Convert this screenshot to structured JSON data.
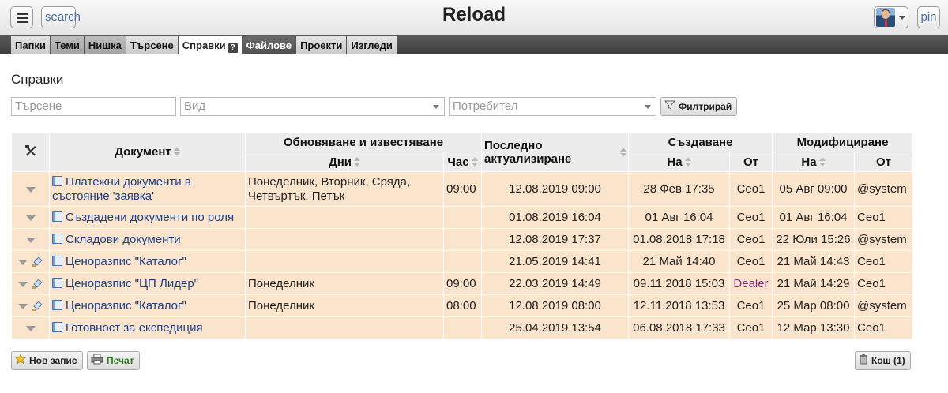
{
  "header": {
    "title": "Reload",
    "search_label": "search",
    "pin_label": "pin"
  },
  "tabs": [
    {
      "label": "Папки"
    },
    {
      "label": "Теми"
    },
    {
      "label": "Нишка"
    },
    {
      "label": "Търсене"
    },
    {
      "label": "Справки"
    },
    {
      "label": "Файлове"
    },
    {
      "label": "Проекти"
    },
    {
      "label": "Изгледи"
    }
  ],
  "page": {
    "title": "Справки"
  },
  "filters": {
    "search_placeholder": "Търсене",
    "type_placeholder": "Вид",
    "user_placeholder": "Потребител",
    "filter_button": "Филтрирай"
  },
  "table": {
    "headers": {
      "document": "Документ",
      "update_group": "Обновяване и известяване",
      "days": "Дни",
      "hour": "Час",
      "last_update": "Последно актуализиране",
      "created_group": "Създаване",
      "modified_group": "Модифициране",
      "on": "На",
      "by": "От"
    },
    "rows": [
      {
        "name": "Платежни документи в състояние 'заявка'",
        "days": "Понеделник, Вторник, Сряда, Четвъртък, Петък",
        "hour": "09:00",
        "last": "12.08.2019 09:00",
        "created_on": "28 Фев 17:35",
        "created_by": "Ceo1",
        "modified_on": "05 Авг 09:00",
        "modified_by": "@system"
      },
      {
        "name": "Създадени документи по роля",
        "days": "",
        "hour": "",
        "last": "01.08.2019 16:04",
        "created_on": "01 Авг 16:04",
        "created_by": "Ceo1",
        "modified_on": "01 Авг 16:04",
        "modified_by": "Ceo1"
      },
      {
        "name": "Складови документи",
        "days": "",
        "hour": "",
        "last": "12.08.2019 17:37",
        "created_on": "01.08.2018 17:18",
        "created_by": "Ceo1",
        "modified_on": "22 Юли 15:26",
        "modified_by": "@system"
      },
      {
        "name": "Ценоразпис \"Каталог\"",
        "days": "",
        "hour": "",
        "last": "21.05.2019 14:41",
        "created_on": "21 Май 14:40",
        "created_by": "Ceo1",
        "modified_on": "21 Май 14:43",
        "modified_by": "Ceo1"
      },
      {
        "name": "Ценоразпис \"ЦП Лидер\"",
        "days": "Понеделник",
        "hour": "09:00",
        "last": "22.03.2019 14:49",
        "created_on": "09.11.2018 15:03",
        "created_by": "Dealer",
        "modified_on": "21 Май 14:29",
        "modified_by": "Ceo1"
      },
      {
        "name": "Ценоразпис \"Каталог\"",
        "days": "Понеделник",
        "hour": "08:00",
        "last": "12.08.2019 08:00",
        "created_on": "12.11.2018 13:53",
        "created_by": "Ceo1",
        "modified_on": "25 Мар 08:00",
        "modified_by": "@system"
      },
      {
        "name": "Готовност за експедиция",
        "days": "",
        "hour": "",
        "last": "25.04.2019 13:54",
        "created_on": "06.08.2018 17:33",
        "created_by": "Ceo1",
        "modified_on": "12 Мар 13:30",
        "modified_by": "Ceo1"
      }
    ]
  },
  "footer": {
    "new_record": "Нов запис",
    "print": "Печат",
    "trash": "Кош (1)"
  }
}
